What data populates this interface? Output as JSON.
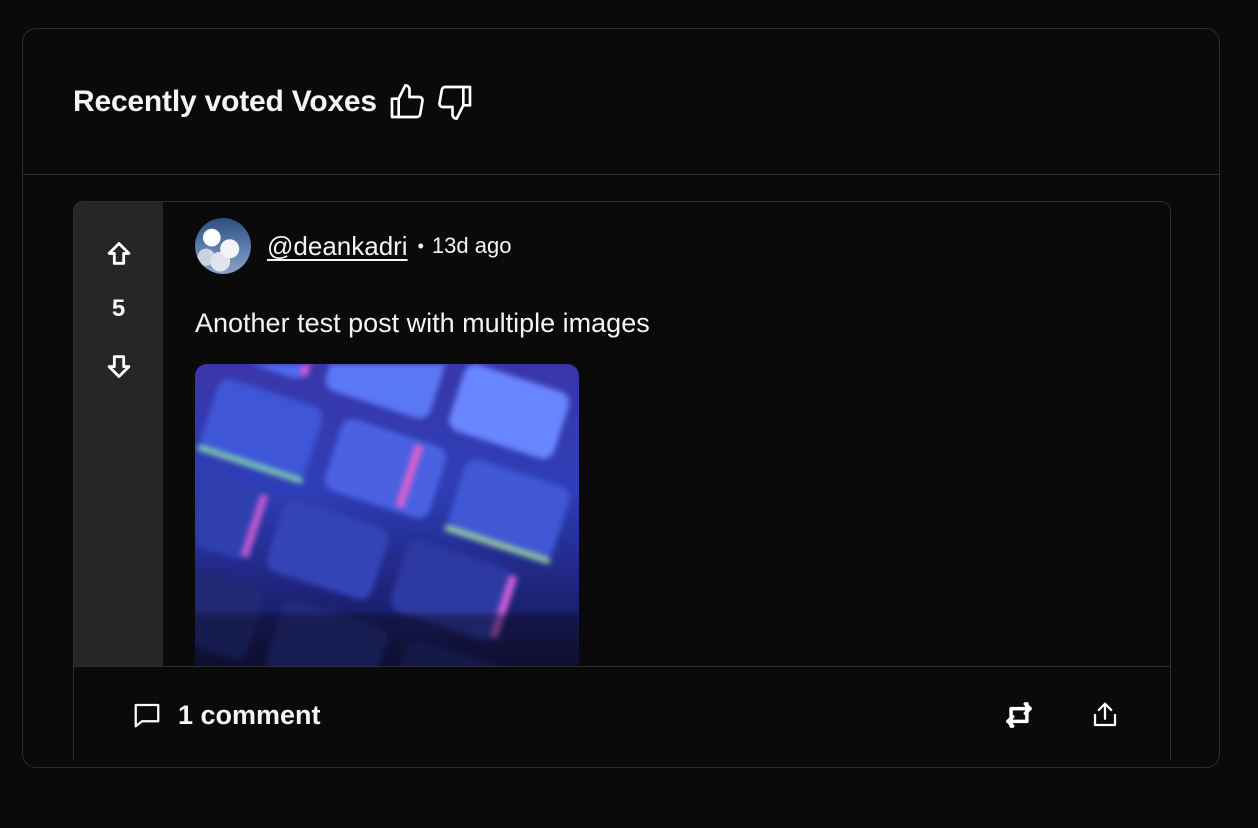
{
  "widget": {
    "title": "Recently voted Voxes",
    "icons": [
      "thumbs-up-icon",
      "thumbs-down-icon"
    ]
  },
  "post": {
    "vote_count": "5",
    "author": "@deankadri",
    "separator": "•",
    "time_ago": "13d ago",
    "text": "Another test post with multiple images",
    "comments_label": "1 comment"
  },
  "colors": {
    "background": "#0a0a0b",
    "border": "#2e2e31",
    "vote_column": "#262627",
    "text": "#f4f4f5"
  }
}
